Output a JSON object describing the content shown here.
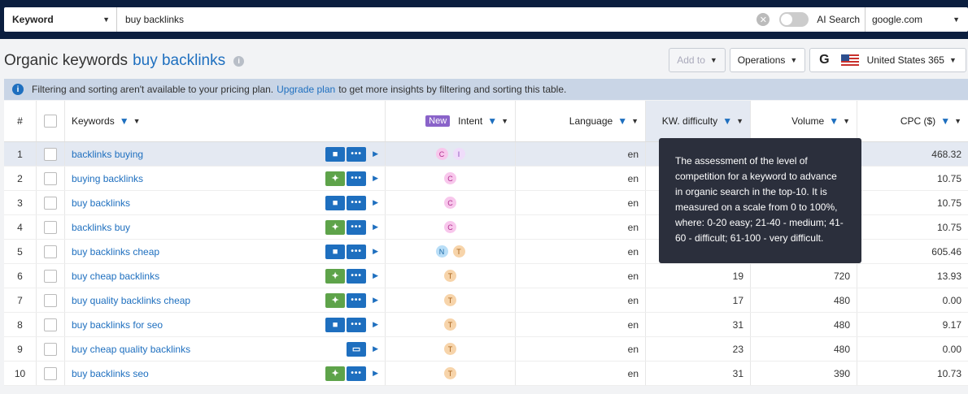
{
  "search": {
    "type_label": "Keyword",
    "query": "buy backlinks",
    "ai_label": "AI Search",
    "database": "google.com"
  },
  "header": {
    "title": "Organic keywords",
    "keyword": "buy backlinks",
    "add_to_label": "Add to",
    "operations_label": "Operations",
    "engine_letter": "G",
    "region_label": "United States 365"
  },
  "notice": {
    "text_before": "Filtering and sorting aren't available to your pricing plan.",
    "link": "Upgrade plan",
    "text_after": "to get more insights by filtering and sorting this table."
  },
  "table": {
    "columns": {
      "num": "#",
      "keywords": "Keywords",
      "new_badge": "New",
      "intent": "Intent",
      "language": "Language",
      "kd": "KW. difficulty",
      "volume": "Volume",
      "cpc": "CPC ($)"
    },
    "rows": [
      {
        "num": "1",
        "keyword": "backlinks buying",
        "serp": [
          "blue",
          "dots"
        ],
        "intents": [
          "C",
          "I"
        ],
        "lang": "en",
        "kd": "",
        "volume": "",
        "cpc": "468.32"
      },
      {
        "num": "2",
        "keyword": "buying backlinks",
        "serp": [
          "green",
          "dots"
        ],
        "intents": [
          "C"
        ],
        "lang": "en",
        "kd": "",
        "volume": "",
        "cpc": "10.75"
      },
      {
        "num": "3",
        "keyword": "buy backlinks",
        "serp": [
          "blue",
          "dots"
        ],
        "intents": [
          "C"
        ],
        "lang": "en",
        "kd": "",
        "volume": "",
        "cpc": "10.75"
      },
      {
        "num": "4",
        "keyword": "backlinks buy",
        "serp": [
          "green",
          "dots"
        ],
        "intents": [
          "C"
        ],
        "lang": "en",
        "kd": "",
        "volume": "",
        "cpc": "10.75"
      },
      {
        "num": "5",
        "keyword": "buy backlinks cheap",
        "serp": [
          "blue",
          "dots"
        ],
        "intents": [
          "N",
          "T"
        ],
        "lang": "en",
        "kd": "",
        "volume": "",
        "cpc": "605.46"
      },
      {
        "num": "6",
        "keyword": "buy cheap backlinks",
        "serp": [
          "green",
          "dots"
        ],
        "intents": [
          "T"
        ],
        "lang": "en",
        "kd": "19",
        "volume": "720",
        "cpc": "13.93"
      },
      {
        "num": "7",
        "keyword": "buy quality backlinks cheap",
        "serp": [
          "green",
          "dots"
        ],
        "intents": [
          "T"
        ],
        "lang": "en",
        "kd": "17",
        "volume": "480",
        "cpc": "0.00"
      },
      {
        "num": "8",
        "keyword": "buy backlinks for seo",
        "serp": [
          "blue",
          "dots"
        ],
        "intents": [
          "T"
        ],
        "lang": "en",
        "kd": "31",
        "volume": "480",
        "cpc": "9.17"
      },
      {
        "num": "9",
        "keyword": "buy cheap quality backlinks",
        "serp": [
          "blue"
        ],
        "intents": [
          "T"
        ],
        "lang": "en",
        "kd": "23",
        "volume": "480",
        "cpc": "0.00"
      },
      {
        "num": "10",
        "keyword": "buy backlinks seo",
        "serp": [
          "green",
          "dots"
        ],
        "intents": [
          "T"
        ],
        "lang": "en",
        "kd": "31",
        "volume": "390",
        "cpc": "10.73"
      }
    ]
  },
  "tooltip": {
    "text": "The assessment of the level of competition for a keyword to advance in organic search in the top-10. It is measured on a scale from 0 to 100%, where: 0-20 easy; 21-40 - medium; 41-60 - difficult; 61-100 - very difficult."
  },
  "colors": {
    "topbar": "#0b1e3f",
    "link": "#1e6fbf",
    "serp_green": "#5ea34a",
    "tooltip_bg": "#2b2f3c"
  }
}
